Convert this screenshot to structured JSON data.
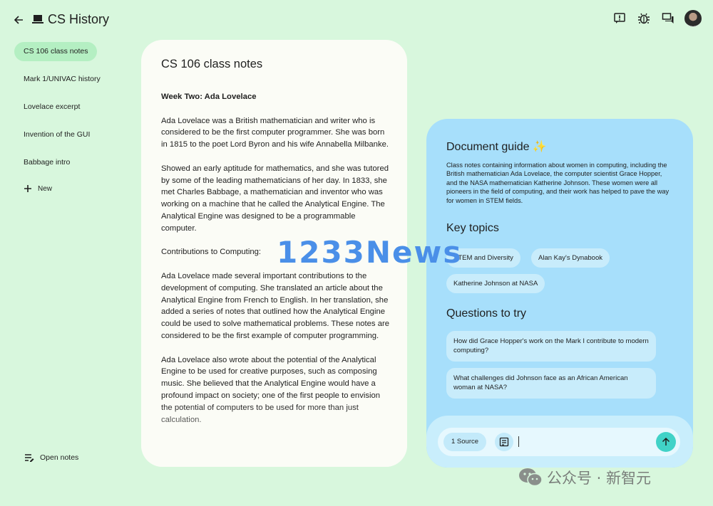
{
  "app": {
    "title": "CS History",
    "back_icon": "arrow-left-icon",
    "app_icon": "laptop-icon"
  },
  "topbar": {
    "icons": [
      "feedback-icon",
      "bug-icon",
      "chat-icon",
      "avatar"
    ]
  },
  "sidebar": {
    "items": [
      {
        "label": "CS 106 class notes",
        "active": true
      },
      {
        "label": "Mark 1/UNIVAC history",
        "active": false
      },
      {
        "label": "Lovelace excerpt",
        "active": false
      },
      {
        "label": "Invention of the GUI",
        "active": false
      },
      {
        "label": "Babbage intro",
        "active": false
      }
    ],
    "new_label": "New",
    "open_notes_label": "Open notes"
  },
  "notes": {
    "title": "CS 106 class notes",
    "week": "Week Two: Ada Lovelace",
    "paragraphs": [
      "Ada Lovelace was a British mathematician and writer who is considered to be the first computer programmer. She was born in 1815 to the poet Lord Byron and his wife Annabella Milbanke.",
      "Showed an early aptitude for mathematics, and she was tutored by some of the leading mathematicians of her day. In 1833, she met Charles Babbage, a mathematician and inventor who was working on a machine that he called the Analytical Engine. The Analytical Engine was designed to be a programmable computer.",
      "Contributions to Computing:",
      "Ada Lovelace made several important contributions to the development of computing. She translated an article about the Analytical Engine from French to English. In her translation, she added a series of notes that outlined how the Analytical Engine could be used to solve mathematical problems. These notes are considered to be the first example of computer programming.",
      "Ada Lovelace also wrote about the potential of the Analytical Engine to be used for creative purposes, such as composing music. She believed that the Analytical Engine would have a profound impact on society; one of the first people to envision the potential of computers to be used for more than just calculation."
    ]
  },
  "guide": {
    "title": "Document guide",
    "summary": "Class notes containing information about women in computing, including the British mathematician Ada Lovelace, the computer scientist Grace Hopper, and the NASA mathematician Katherine Johnson. These women were all pioneers in the field of computing, and their work has helped to pave the way for women in STEM fields.",
    "topics_title": "Key topics",
    "topics": [
      "STEM and Diversity",
      "Alan Kay's Dynabook",
      "Katherine Johnson at NASA"
    ],
    "questions_title": "Questions to try",
    "questions": [
      "How did Grace Hopper's work on the Mark I contribute to modern computing?",
      "What challenges did Johnson face as an African American woman at NASA?"
    ]
  },
  "input": {
    "source_label": "1 Source",
    "value": ""
  },
  "watermarks": {
    "news": "1233News",
    "wechat": "公众号 · 新智元"
  },
  "colors": {
    "background": "#d8f7dd",
    "active_item": "#b4efc2",
    "guide_panel": "#a7dffb",
    "send_button": "#41d2c7"
  }
}
